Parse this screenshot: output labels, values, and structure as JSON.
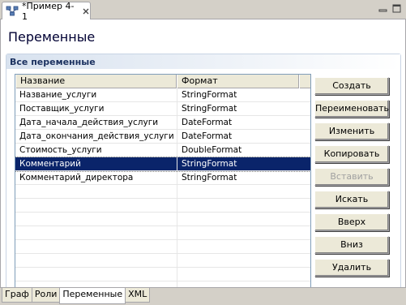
{
  "editor": {
    "tab_title": "*Пример 4-1",
    "tab_icon": "process-icon"
  },
  "page_title": "Переменные",
  "section_title": "Все переменные",
  "table": {
    "columns": [
      "Название",
      "Формат"
    ],
    "rows": [
      {
        "name": "Название_услуги",
        "format": "StringFormat"
      },
      {
        "name": "Поставщик_услуги",
        "format": "StringFormat"
      },
      {
        "name": "Дата_начала_действия_услуги",
        "format": "DateFormat"
      },
      {
        "name": "Дата_окончания_действия_услуги",
        "format": "DateFormat"
      },
      {
        "name": "Стоимость_услуги",
        "format": "DoubleFormat"
      },
      {
        "name": "Комментарий",
        "format": "StringFormat",
        "selected": true
      },
      {
        "name": "Комментарий_директора",
        "format": "StringFormat"
      }
    ],
    "empty_rows": 8
  },
  "buttons": [
    {
      "label": "Создать",
      "name": "create-button",
      "enabled": true
    },
    {
      "label": "Переименовать",
      "name": "rename-button",
      "enabled": true
    },
    {
      "label": "Изменить",
      "name": "edit-button",
      "enabled": true
    },
    {
      "label": "Копировать",
      "name": "copy-button",
      "enabled": true
    },
    {
      "label": "Вставить",
      "name": "paste-button",
      "enabled": false
    },
    {
      "label": "Искать",
      "name": "search-button",
      "enabled": true
    },
    {
      "label": "Вверх",
      "name": "move-up-button",
      "enabled": true
    },
    {
      "label": "Вниз",
      "name": "move-down-button",
      "enabled": true
    },
    {
      "label": "Удалить",
      "name": "delete-button",
      "enabled": true
    }
  ],
  "bottom_tabs": [
    {
      "label": "Граф",
      "active": false
    },
    {
      "label": "Роли",
      "active": false
    },
    {
      "label": "Переменные",
      "active": true
    },
    {
      "label": "XML",
      "active": false
    }
  ],
  "colors": {
    "selection": "#0a246a",
    "section_header_text": "#1c3260"
  }
}
